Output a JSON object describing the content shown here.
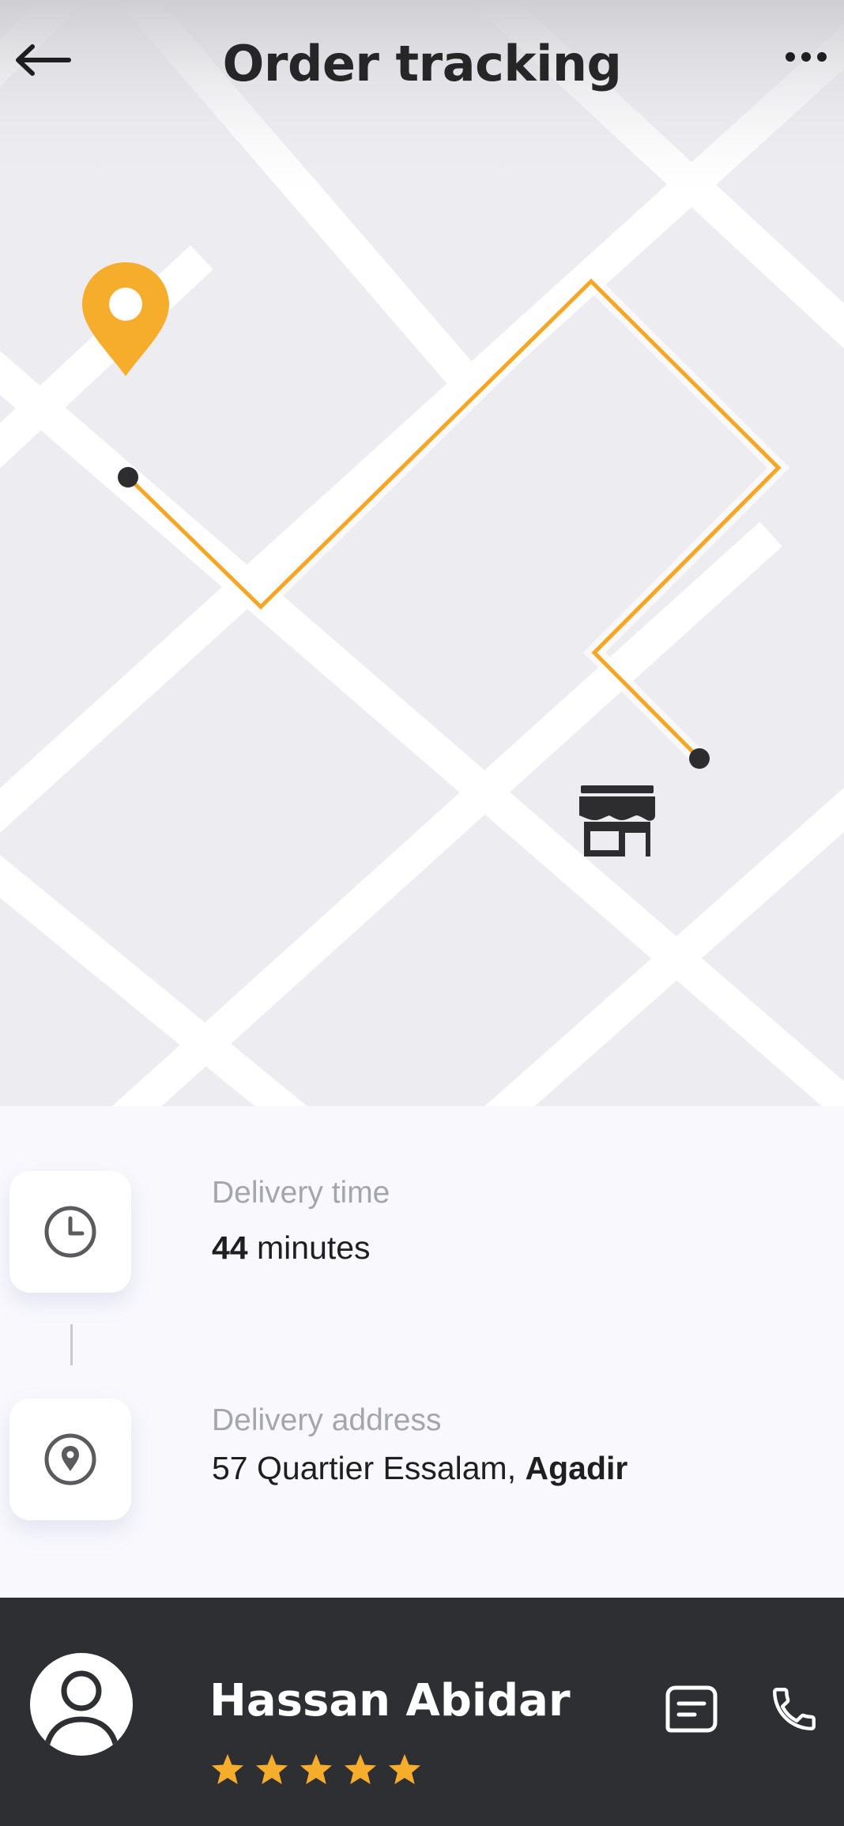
{
  "header": {
    "title": "Order tracking",
    "back_icon": "arrow-left-icon",
    "more_icon": "more-horizontal-icon"
  },
  "map": {
    "pin_icon": "location-pin-icon",
    "store_icon": "store-icon",
    "route_color": "#f6a623",
    "pin_color": "#f6ad2b"
  },
  "delivery": {
    "time_label": "Delivery time",
    "time_value": "44",
    "time_unit": " minutes",
    "address_label": "Delivery address",
    "address_street": "57 Quartier Essalam, ",
    "address_city": "Agadir"
  },
  "driver": {
    "name": "Hassan Abidar",
    "rating": 5,
    "star_color": "#f6ad2b",
    "chat_icon": "message-icon",
    "call_icon": "phone-icon"
  }
}
